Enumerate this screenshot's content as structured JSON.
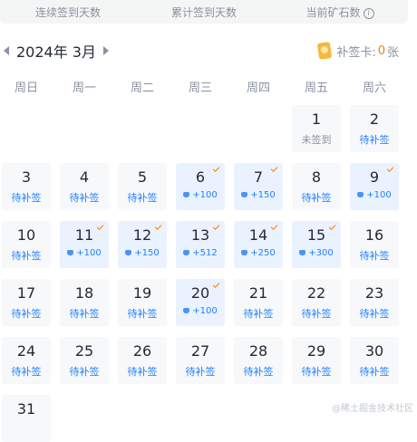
{
  "stats": {
    "consecutive_label": "连续签到天数",
    "total_label": "累计签到天数",
    "ore_label": "当前矿石数"
  },
  "calendar": {
    "month_label": "2024年 3月",
    "card_label": "补签卡:",
    "card_count": "0",
    "card_unit": "张",
    "weekdays": [
      "周日",
      "周一",
      "周二",
      "周三",
      "周四",
      "周五",
      "周六"
    ],
    "days": [
      {
        "num": "1",
        "status": "未签到",
        "reward": "",
        "signed": false,
        "checked": false
      },
      {
        "num": "2",
        "status": "待补签",
        "reward": "",
        "signed": false,
        "checked": false
      },
      {
        "num": "3",
        "status": "待补签",
        "reward": "",
        "signed": false,
        "checked": false
      },
      {
        "num": "4",
        "status": "待补签",
        "reward": "",
        "signed": false,
        "checked": false
      },
      {
        "num": "5",
        "status": "待补签",
        "reward": "",
        "signed": false,
        "checked": false
      },
      {
        "num": "6",
        "status": "",
        "reward": "+100",
        "signed": true,
        "checked": true
      },
      {
        "num": "7",
        "status": "",
        "reward": "+150",
        "signed": true,
        "checked": true
      },
      {
        "num": "8",
        "status": "待补签",
        "reward": "",
        "signed": false,
        "checked": false
      },
      {
        "num": "9",
        "status": "",
        "reward": "+100",
        "signed": true,
        "checked": true
      },
      {
        "num": "10",
        "status": "待补签",
        "reward": "",
        "signed": false,
        "checked": false
      },
      {
        "num": "11",
        "status": "",
        "reward": "+100",
        "signed": true,
        "checked": true
      },
      {
        "num": "12",
        "status": "",
        "reward": "+150",
        "signed": true,
        "checked": true
      },
      {
        "num": "13",
        "status": "",
        "reward": "+512",
        "signed": true,
        "checked": true
      },
      {
        "num": "14",
        "status": "",
        "reward": "+250",
        "signed": true,
        "checked": true
      },
      {
        "num": "15",
        "status": "",
        "reward": "+300",
        "signed": true,
        "checked": true
      },
      {
        "num": "16",
        "status": "待补签",
        "reward": "",
        "signed": false,
        "checked": false
      },
      {
        "num": "17",
        "status": "待补签",
        "reward": "",
        "signed": false,
        "checked": false
      },
      {
        "num": "18",
        "status": "待补签",
        "reward": "",
        "signed": false,
        "checked": false
      },
      {
        "num": "19",
        "status": "待补签",
        "reward": "",
        "signed": false,
        "checked": false
      },
      {
        "num": "20",
        "status": "",
        "reward": "+100",
        "signed": true,
        "checked": true
      },
      {
        "num": "21",
        "status": "待补签",
        "reward": "",
        "signed": false,
        "checked": false
      },
      {
        "num": "22",
        "status": "待补签",
        "reward": "",
        "signed": false,
        "checked": false
      },
      {
        "num": "23",
        "status": "待补签",
        "reward": "",
        "signed": false,
        "checked": false
      },
      {
        "num": "24",
        "status": "待补签",
        "reward": "",
        "signed": false,
        "checked": false
      },
      {
        "num": "25",
        "status": "待补签",
        "reward": "",
        "signed": false,
        "checked": false
      },
      {
        "num": "26",
        "status": "待补签",
        "reward": "",
        "signed": false,
        "checked": false
      },
      {
        "num": "27",
        "status": "待补签",
        "reward": "",
        "signed": false,
        "checked": false
      },
      {
        "num": "28",
        "status": "待补签",
        "reward": "",
        "signed": false,
        "checked": false
      },
      {
        "num": "29",
        "status": "待补签",
        "reward": "",
        "signed": false,
        "checked": false
      },
      {
        "num": "30",
        "status": "待补签",
        "reward": "",
        "signed": false,
        "checked": false
      },
      {
        "num": "31",
        "status": "",
        "reward": "",
        "signed": false,
        "checked": false
      }
    ]
  },
  "icons": {
    "card": "sign-card-icon",
    "gem": "ore-gem-icon",
    "check": "signed-check-icon",
    "info": "info-icon"
  },
  "colors": {
    "accent": "#1e80ff",
    "signed_bg": "#eaf2ff",
    "cell_bg": "#f7f8fa",
    "check": "#ff7d00"
  },
  "watermark": "@稀土掘金技术社区"
}
